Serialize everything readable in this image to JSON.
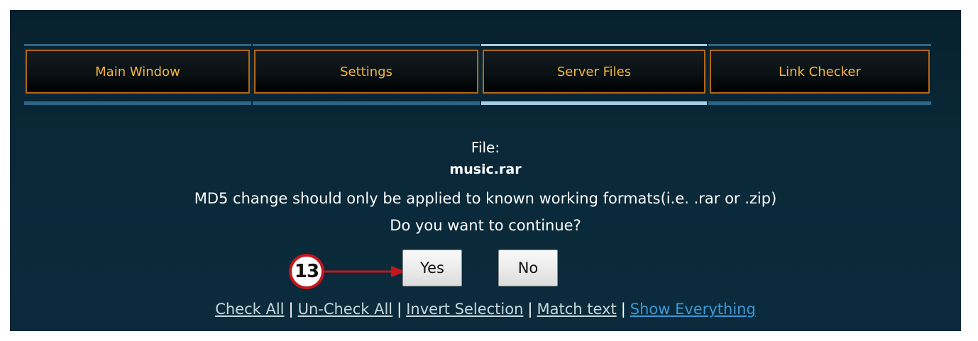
{
  "tabs": [
    {
      "label": "Main Window",
      "active": false
    },
    {
      "label": "Settings",
      "active": false
    },
    {
      "label": "Server Files",
      "active": true
    },
    {
      "label": "Link Checker",
      "active": false
    }
  ],
  "dialog": {
    "file_label": "File:",
    "file_name": "music.rar",
    "warning": "MD5 change should only be applied to known working formats(i.e. .rar or .zip)",
    "question": "Do you want to continue?",
    "yes_label": "Yes",
    "no_label": "No"
  },
  "callout": {
    "number": "13",
    "color": "#c4161c"
  },
  "links": {
    "check_all": "Check All",
    "uncheck_all": "Un-Check All",
    "invert_selection": "Invert Selection",
    "match_text": "Match text",
    "show_everything": "Show Everything",
    "separator": "|"
  },
  "colors": {
    "background": "#0a2838",
    "tab_border": "#b56614",
    "tab_text": "#f5b63a",
    "active_tab_line": "#a3cde4",
    "link_highlight": "#3a97d8"
  }
}
